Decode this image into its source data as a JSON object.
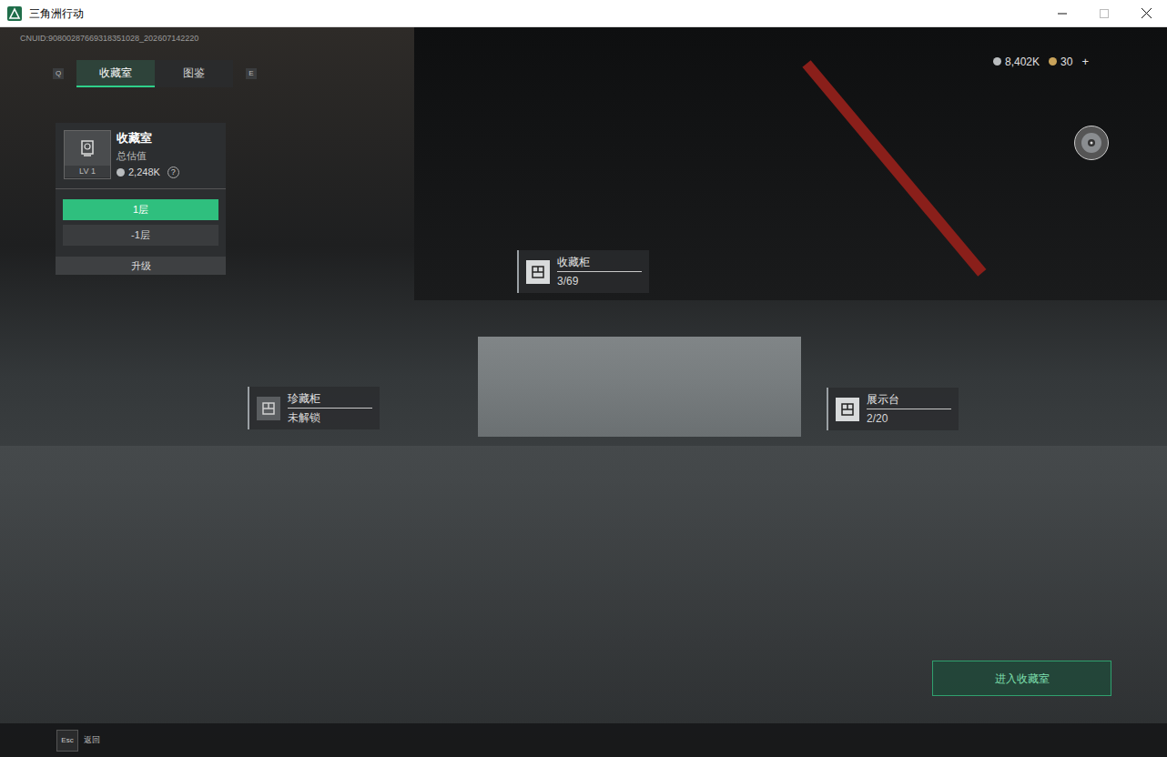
{
  "window": {
    "title": "三角洲行动"
  },
  "uid": "CNUID:90800287669318351028_202607142220",
  "tabs": [
    {
      "label": "收藏室",
      "selected": true
    },
    {
      "label": "图鉴",
      "selected": false
    }
  ],
  "tab_keys": {
    "left": "Q",
    "right": "E"
  },
  "panel": {
    "title": "收藏室",
    "level": "LV 1",
    "value_label": "总估值",
    "value": "2,248K",
    "help": "?",
    "floors": [
      {
        "label": "1层",
        "selected": true
      },
      {
        "label": "-1层",
        "selected": false
      }
    ],
    "upgrade": "升级"
  },
  "currency": [
    {
      "amount": "8,402K"
    },
    {
      "amount": "30"
    }
  ],
  "currency_add": "+",
  "markers": [
    {
      "title": "收藏柜",
      "value": "3/69",
      "locked": false
    },
    {
      "title": "珍藏柜",
      "value": "未解锁",
      "locked": true
    },
    {
      "title": "展示台",
      "value": "2/20",
      "locked": false
    }
  ],
  "enter_button": "进入收藏室",
  "footer": {
    "key": "Esc",
    "label": "返回"
  }
}
